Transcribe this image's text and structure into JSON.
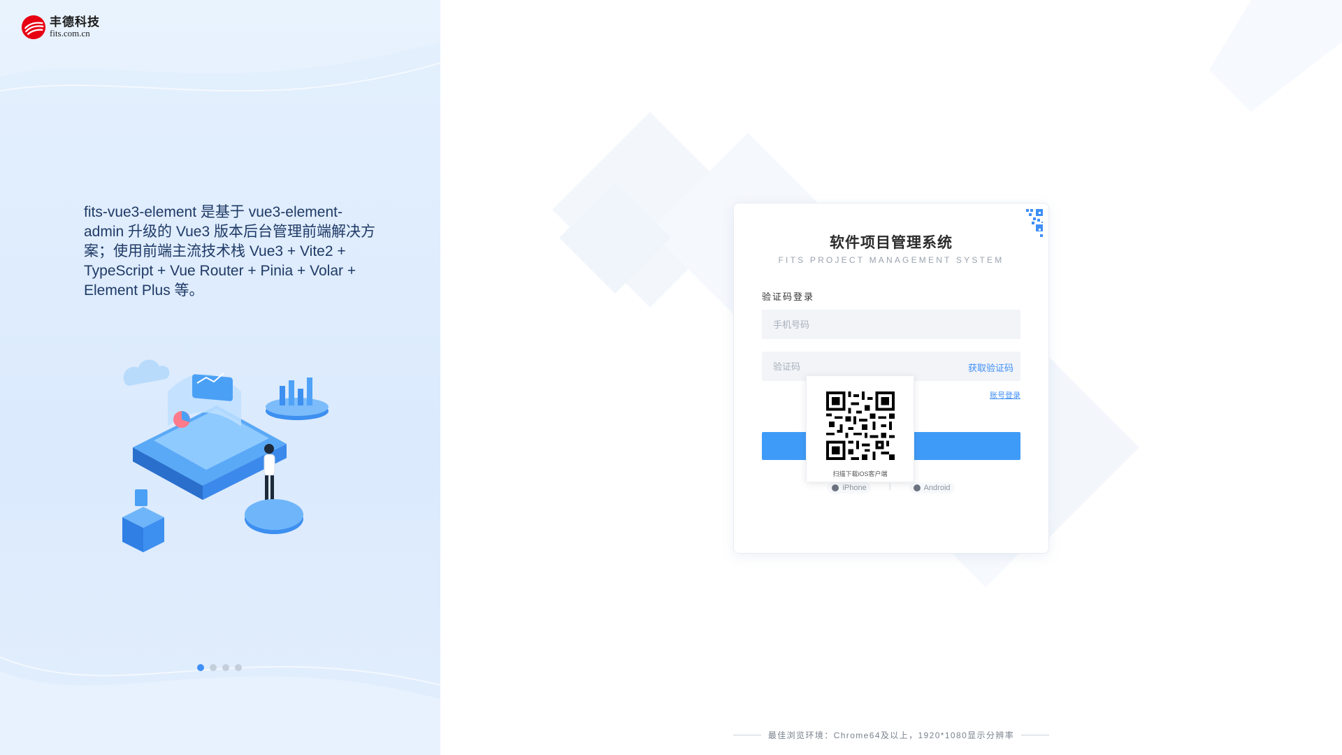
{
  "brand": {
    "name": "丰德科技",
    "domain": "fits.com.cn",
    "color": "#e60012"
  },
  "intro": {
    "text": "fits-vue3-element 是基于 vue3-element-admin 升级的 Vue3 版本后台管理前端解决方案；使用前端主流技术栈 Vue3 + Vite2 + TypeScript + Vue Router + Pinia + Volar + Element Plus 等。"
  },
  "carousel": {
    "count": 4,
    "active": 1
  },
  "login": {
    "title": "软件项目管理系统",
    "subtitle": "FITS PROJECT  MANAGEMENT SYSTEM",
    "mode_label": "验证码登录",
    "phone_placeholder": "手机号码",
    "phone_value": "",
    "code_placeholder": "验证码",
    "code_value": "",
    "get_code_label": "获取验证码",
    "account_login_label": "账号登录",
    "submit_label": "",
    "qr_caption": "扫描下载iOS客户端",
    "iphone_label": "iPhone",
    "android_label": "Android"
  },
  "footer": {
    "text": "最佳浏览环境：Chrome64及以上，1920*1080显示分辨率"
  },
  "colors": {
    "accent": "#3f9bf8",
    "link": "#3f8ff7",
    "left_bg": "#e0edfc"
  },
  "icons": {
    "corner": "qr-code-icon",
    "iphone": "apple-icon",
    "android": "android-icon"
  }
}
